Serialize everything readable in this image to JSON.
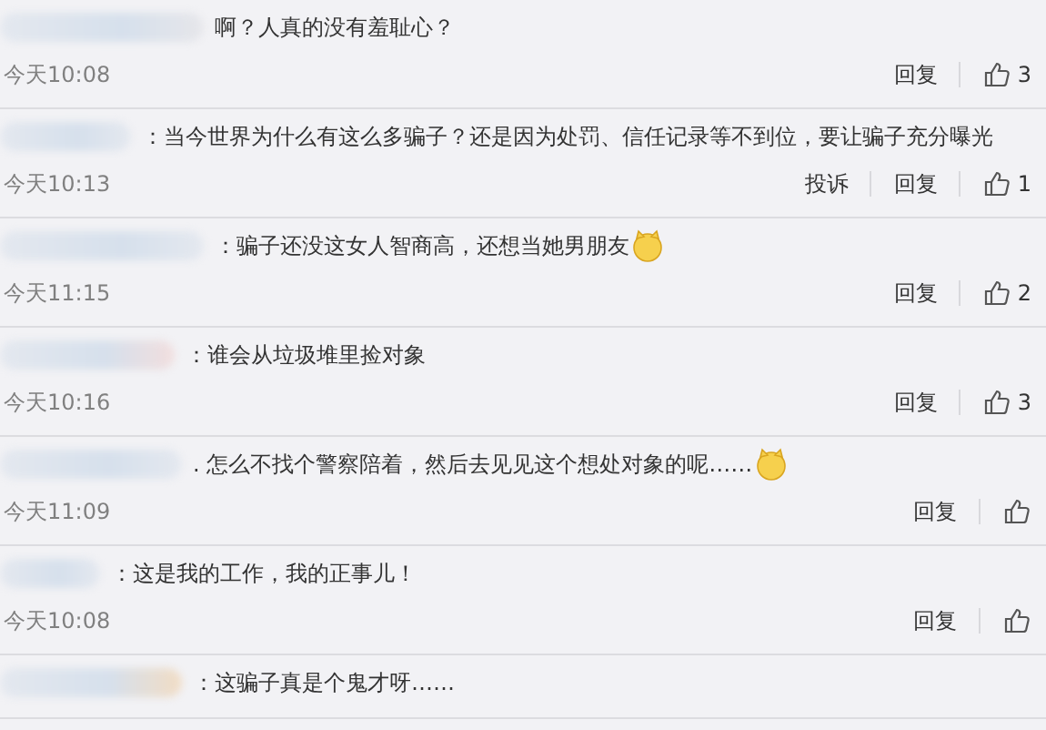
{
  "comments": [
    {
      "text": "啊？人真的没有羞耻心？",
      "emoji": false,
      "time": "今天10:08",
      "reply": "回复",
      "likes": "3"
    },
    {
      "text": "：当今世界为什么有这么多骗子？还是因为处罚、信任记录等不到位，要让骗子充分曝光",
      "emoji": false,
      "time": "今天10:13",
      "report": "投诉",
      "reply": "回复",
      "likes": "1"
    },
    {
      "text": "：骗子还没这女人智商高，还想当她男朋友",
      "emoji": true,
      "time": "今天11:15",
      "reply": "回复",
      "likes": "2"
    },
    {
      "text": "：谁会从垃圾堆里捡对象",
      "emoji": false,
      "time": "今天10:16",
      "reply": "回复",
      "likes": "3"
    },
    {
      "text": ". 怎么不找个警察陪着，然后去见见这个想处对象的呢……",
      "emoji": true,
      "time": "今天11:09",
      "reply": "回复"
    },
    {
      "text": "：这是我的工作，我的正事儿！",
      "emoji": false,
      "time": "今天10:08",
      "reply": "回复"
    },
    {
      "text": "：这骗子真是个鬼才呀……",
      "emoji": false
    }
  ]
}
